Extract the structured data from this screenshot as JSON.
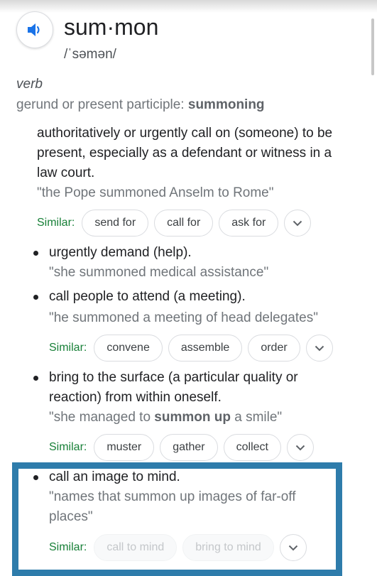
{
  "entry": {
    "word": "sum·mon",
    "phonetic": "/ˈsəmən/",
    "part_of_speech": "verb",
    "gerund_label": "gerund or present participle:",
    "gerund_value": "summoning"
  },
  "icons": {
    "speaker": "speaker-icon",
    "chevron": "chevron-down-icon"
  },
  "colors": {
    "similar_label": "#188038",
    "highlight_border": "#2e7cab",
    "speaker": "#1a73e8"
  },
  "similar_label": "Similar:",
  "senses": [
    {
      "definition_lines": [
        "authoritatively or urgently call on (someone) to be",
        "present, especially as a defendant or witness in a",
        "law court."
      ],
      "example": "\"the Pope summoned Anselm to Rome\"",
      "similar": [
        "send for",
        "call for",
        "ask for"
      ]
    },
    {
      "definition": "urgently demand (help).",
      "example": "\"she summoned medical assistance\""
    },
    {
      "definition": "call people to attend (a meeting).",
      "example": "\"he summoned a meeting of head delegates\"",
      "similar": [
        "convene",
        "assemble",
        "order"
      ]
    },
    {
      "definition_lines": [
        "bring to the surface (a particular quality or",
        "reaction) from within oneself."
      ],
      "example_pre": "\"she managed to ",
      "example_bold": "summon up",
      "example_post": " a smile\"",
      "similar": [
        "muster",
        "gather",
        "collect"
      ]
    },
    {
      "definition": "call an image to mind.",
      "example_lines": [
        "\"names that summon up images of far-off",
        "places\""
      ],
      "similar": [
        "call to mind",
        "bring to mind"
      ]
    }
  ]
}
